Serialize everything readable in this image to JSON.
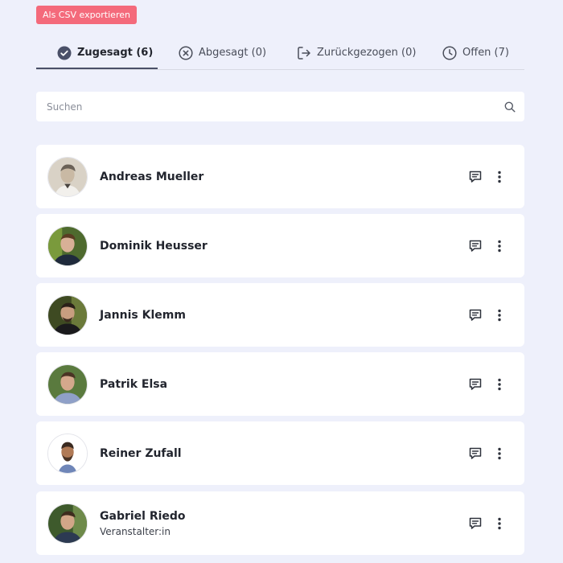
{
  "export_label": "Als CSV exportieren",
  "tabs": [
    {
      "label": "Zugesagt (6)",
      "icon": "check-circle-icon"
    },
    {
      "label": "Abgesagt (0)",
      "icon": "x-circle-icon"
    },
    {
      "label": "Zurückgezogen (0)",
      "icon": "sign-out-icon"
    },
    {
      "label": "Offen (7)",
      "icon": "clock-icon"
    }
  ],
  "search": {
    "placeholder": "Suchen"
  },
  "attendees": [
    {
      "name": "Andreas Mueller",
      "role": ""
    },
    {
      "name": "Dominik Heusser",
      "role": ""
    },
    {
      "name": "Jannis Klemm",
      "role": ""
    },
    {
      "name": "Patrik Elsa",
      "role": ""
    },
    {
      "name": "Reiner Zufall",
      "role": ""
    },
    {
      "name": "Gabriel Riedo",
      "role": "Veranstalter:in"
    }
  ],
  "colors": {
    "export": "#f46a7b",
    "background": "#eef0fb",
    "accent": "#4a5068"
  }
}
